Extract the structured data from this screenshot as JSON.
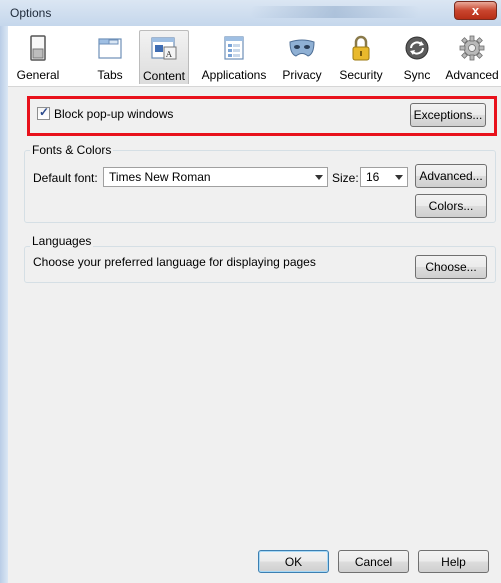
{
  "window": {
    "title": "Options",
    "close_glyph": "x"
  },
  "panes": [
    {
      "label": "General",
      "icon": "general-switch-icon"
    },
    {
      "label": "Tabs",
      "icon": "tabs-window-icon"
    },
    {
      "label": "Content",
      "icon": "content-page-icon",
      "active": true
    },
    {
      "label": "Applications",
      "icon": "applications-list-icon"
    },
    {
      "label": "Privacy",
      "icon": "privacy-mask-icon"
    },
    {
      "label": "Security",
      "icon": "security-lock-icon"
    },
    {
      "label": "Sync",
      "icon": "sync-arrows-icon"
    },
    {
      "label": "Advanced",
      "icon": "advanced-gear-icon"
    }
  ],
  "popup": {
    "checkbox_label": "Block pop-up windows",
    "checked": true,
    "exceptions_button": "Exceptions..."
  },
  "fonts_colors": {
    "legend": "Fonts & Colors",
    "default_font_label": "Default font:",
    "default_font_value": "Times New Roman",
    "size_label": "Size:",
    "size_value": "16",
    "advanced_button": "Advanced...",
    "colors_button": "Colors..."
  },
  "languages": {
    "legend": "Languages",
    "description": "Choose your preferred language for displaying pages",
    "choose_button": "Choose..."
  },
  "footer": {
    "ok_button": "OK",
    "cancel_button": "Cancel",
    "help_button": "Help"
  },
  "colors": {
    "highlight": "#e8111b",
    "accent": "#3c7fb1"
  }
}
